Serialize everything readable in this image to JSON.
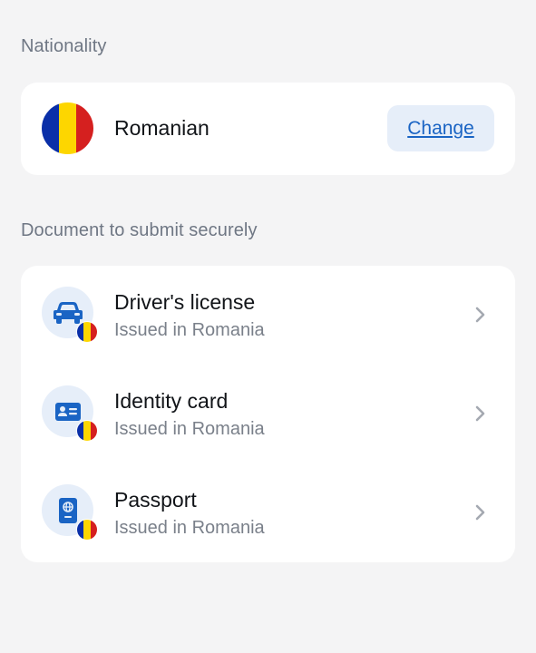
{
  "nationality": {
    "section_label": "Nationality",
    "value": "Romanian",
    "change_label": "Change",
    "flag_colors": [
      "#0a2fa8",
      "#fdd600",
      "#d5201f"
    ]
  },
  "documents": {
    "section_label": "Document to submit securely",
    "items": [
      {
        "title": "Driver's license",
        "subtitle": "Issued in Romania",
        "icon": "car-icon"
      },
      {
        "title": "Identity card",
        "subtitle": "Issued in Romania",
        "icon": "id-card-icon"
      },
      {
        "title": "Passport",
        "subtitle": "Issued in Romania",
        "icon": "passport-icon"
      }
    ]
  },
  "colors": {
    "accent": "#1a64c4",
    "accent_bg": "#e6eef9",
    "page_bg": "#f4f4f5",
    "card_bg": "#ffffff",
    "muted_text": "#7a808a"
  }
}
